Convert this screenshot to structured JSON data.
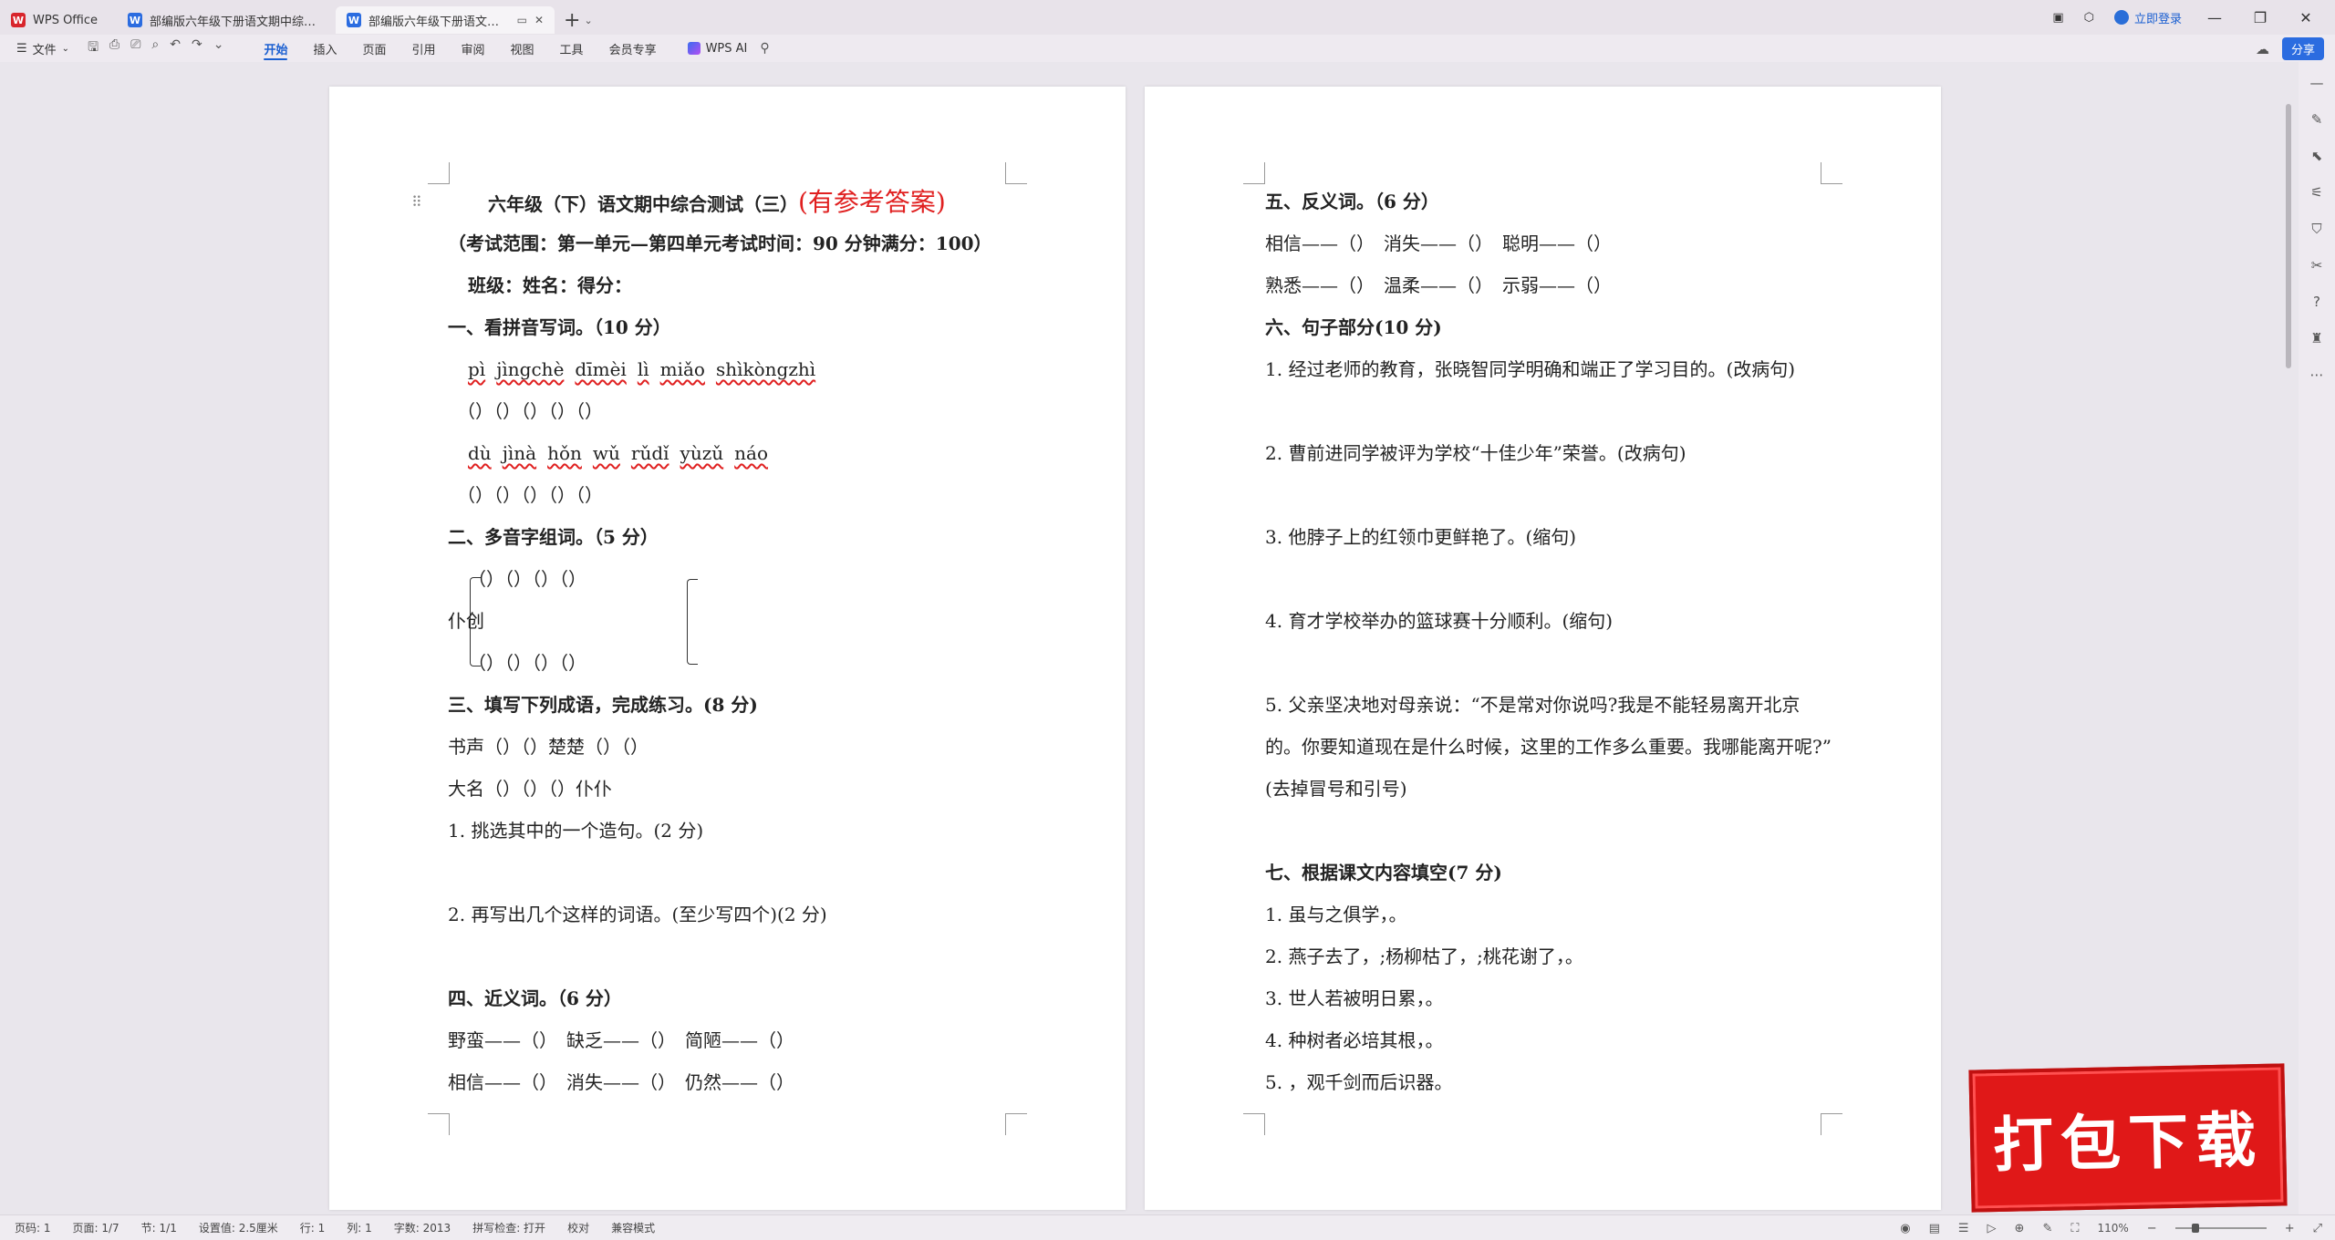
{
  "titlebar": {
    "app_tab": "WPS Office",
    "tabs": [
      {
        "label": "部编版六年级下册语文期中综合测试"
      },
      {
        "label": "部编版六年级下册语文期中综合测试"
      }
    ],
    "login": "立即登录"
  },
  "ribbon": {
    "file": "文件",
    "tabs": [
      "开始",
      "插入",
      "页面",
      "引用",
      "审阅",
      "视图",
      "工具",
      "会员专享"
    ],
    "ai": "WPS AI",
    "share": "分享"
  },
  "page1": {
    "title": "六年级（下）语文期中综合测试（三）",
    "title_red": "(有参考答案)",
    "scope": "（考试范围：第一单元—第四单元考试时间：90 分钟满分：100）",
    "classline": "班级：姓名：得分：",
    "s1": "一、看拼音写词。（10 分）",
    "pinyin1": [
      "pì",
      "jìngchè",
      "dīmèi",
      "lì",
      "miǎo",
      "shìkòngzhì"
    ],
    "blanks1": "（）（）（）（）（）",
    "pinyin2": [
      "dù",
      "jìnà",
      "hǒn",
      "wǔ",
      "rǔdǐ",
      "yùzǔ",
      "náo"
    ],
    "blanks2": "（）（）（）（）（）",
    "s2": "二、多音字组词。（5 分）",
    "poly_top": "（）（）（）（）",
    "poly_chars": "仆创",
    "poly_bottom": "（）（）（）（）",
    "s3": "三、填写下列成语，完成练习。(8 分)",
    "idiom1": "书声（）（）楚楚（）（）",
    "idiom2": "大名（）（）（）仆仆",
    "q1": "1. 挑选其中的一个造句。(2 分)",
    "q2": "2. 再写出几个这样的词语。(至少写四个)(2 分)",
    "s4": "四、近义词。（6 分）",
    "syn1": "野蛮——（）　缺乏——（）　简陋——（）",
    "syn2": "相信——（）　消失——（）　仍然——（）"
  },
  "page2": {
    "s5": "五、反义词。（6 分）",
    "ant1": "相信——（）　消失——（）　聪明——（）",
    "ant2": "熟悉——（）　温柔——（）　示弱——（）",
    "s6": "六、句子部分(10 分)",
    "sent1": "1. 经过老师的教育，张晓智同学明确和端正了学习目的。(改病句)",
    "sent2": "2. 曹前进同学被评为学校“十佳少年”荣誉。(改病句)",
    "sent3": "3. 他脖子上的红领巾更鲜艳了。(缩句)",
    "sent4": "4. 育才学校举办的篮球赛十分顺利。(缩句)",
    "sent5a": "5. 父亲坚决地对母亲说：“不是常对你说吗?我是不能轻易离开北京",
    "sent5b": "的。你要知道现在是什么时候，这里的工作多么重要。我哪能离开呢?”",
    "sent5c": "(去掉冒号和引号)",
    "s7": "七、根据课文内容填空(7 分)",
    "fill1": "1. 虽与之俱学，。",
    "fill2": "2. 燕子去了，;杨柳枯了，;桃花谢了，。",
    "fill3": "3. 世人若被明日累，。",
    "fill4": "4. 种树者必培其根，。",
    "fill5": "5. ，观千剑而后识器。"
  },
  "statusbar": {
    "page": "页码: 1",
    "pages": "页面: 1/7",
    "section": "节: 1/1",
    "setting": "设置值: 2.5厘米",
    "row": "行: 1",
    "col": "列: 1",
    "words": "字数: 2013",
    "spell": "拼写检查: 打开",
    "proof": "校对",
    "compat": "兼容模式",
    "zoom": "110%",
    "zoom_level_percent": 110
  },
  "banner": {
    "text": "打包下载"
  }
}
